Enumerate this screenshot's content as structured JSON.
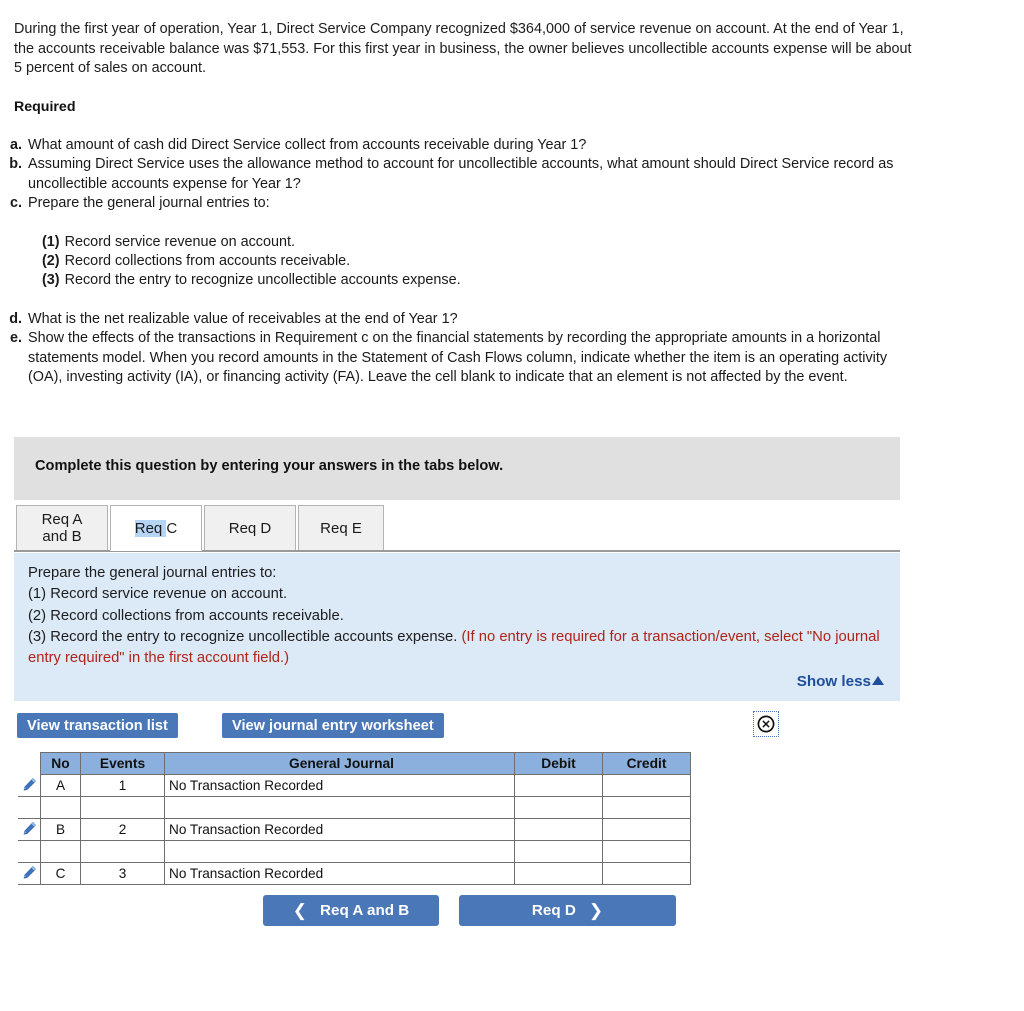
{
  "problem": {
    "paragraph": "During the first year of operation, Year 1, Direct Service Company recognized $364,000 of service revenue on account. At the end of Year 1, the accounts receivable balance was $71,553. For this first year in business, the owner believes uncollectible accounts expense will be about 5 percent of sales on account."
  },
  "required": {
    "heading": "Required",
    "items": [
      {
        "marker": "a.",
        "text": "What amount of cash did Direct Service collect from accounts receivable during Year 1?"
      },
      {
        "marker": "b.",
        "text": "Assuming Direct Service uses the allowance method to account for uncollectible accounts, what amount should Direct Service record as uncollectible accounts expense for Year 1?"
      },
      {
        "marker": "c.",
        "text": "Prepare the general journal entries to:"
      }
    ],
    "sub_items": [
      {
        "marker": "(1)",
        "text": "Record service revenue on account."
      },
      {
        "marker": "(2)",
        "text": "Record collections from accounts receivable."
      },
      {
        "marker": "(3)",
        "text": "Record the entry to recognize uncollectible accounts expense."
      }
    ],
    "items_tail": [
      {
        "marker": "d.",
        "text": "What is the net realizable value of receivables at the end of Year 1?"
      },
      {
        "marker": "e.",
        "text": "Show the effects of the transactions in Requirement c on the financial statements by recording the appropriate amounts in a horizontal statements model. When you record amounts in the Statement of Cash Flows column, indicate whether the item is an operating activity (OA), investing activity (IA), or financing activity (FA). Leave the cell blank to indicate that an element is not affected by the event."
      }
    ]
  },
  "banner": {
    "text": "Complete this question by entering your answers in the tabs below."
  },
  "tabs": [
    {
      "id": "req-a-and-b",
      "line1": "Req A",
      "line2": "and B",
      "active": false
    },
    {
      "id": "req-c",
      "label_selected": "Req ",
      "label_rest": "C",
      "active": true
    },
    {
      "id": "req-d",
      "label": "Req D",
      "active": false
    },
    {
      "id": "req-e",
      "label": "Req E",
      "active": false
    }
  ],
  "instruction": {
    "line1": "Prepare the general journal entries to:",
    "line2": "(1) Record service revenue on account.",
    "line3": "(2) Record collections from accounts receivable.",
    "line4": "(3) Record the entry to recognize uncollectible accounts expense.",
    "note": "(If no entry is required for a transaction/event, select \"No journal entry required\" in the first account field.)",
    "show_less_label": "Show less"
  },
  "toolbar": {
    "view_transaction_list_label": "View transaction list",
    "view_journal_entry_worksheet_label": "View journal entry worksheet"
  },
  "journal_table": {
    "headers": [
      "No",
      "Events",
      "General Journal",
      "Debit",
      "Credit"
    ],
    "rows": [
      {
        "editable": true,
        "no": "A",
        "events": "1",
        "general_journal": "No Transaction Recorded",
        "debit": "",
        "credit": ""
      },
      {
        "editable": false,
        "no": "",
        "events": "",
        "general_journal": "",
        "debit": "",
        "credit": ""
      },
      {
        "editable": true,
        "no": "B",
        "events": "2",
        "general_journal": "No Transaction Recorded",
        "debit": "",
        "credit": ""
      },
      {
        "editable": false,
        "no": "",
        "events": "",
        "general_journal": "",
        "debit": "",
        "credit": ""
      },
      {
        "editable": true,
        "no": "C",
        "events": "3",
        "general_journal": "No Transaction Recorded",
        "debit": "",
        "credit": ""
      }
    ]
  },
  "nav": {
    "prev_label": "Req A and B",
    "next_label": "Req D"
  },
  "colors": {
    "accent_blue": "#4a77b8",
    "panel_blue": "#dce9f7",
    "banner_gray": "#e0e0e0",
    "table_header_blue": "#8cb0dd",
    "note_red": "#b02418",
    "link_blue": "#1f4e9c",
    "selection_blue": "#b6d5f5"
  }
}
